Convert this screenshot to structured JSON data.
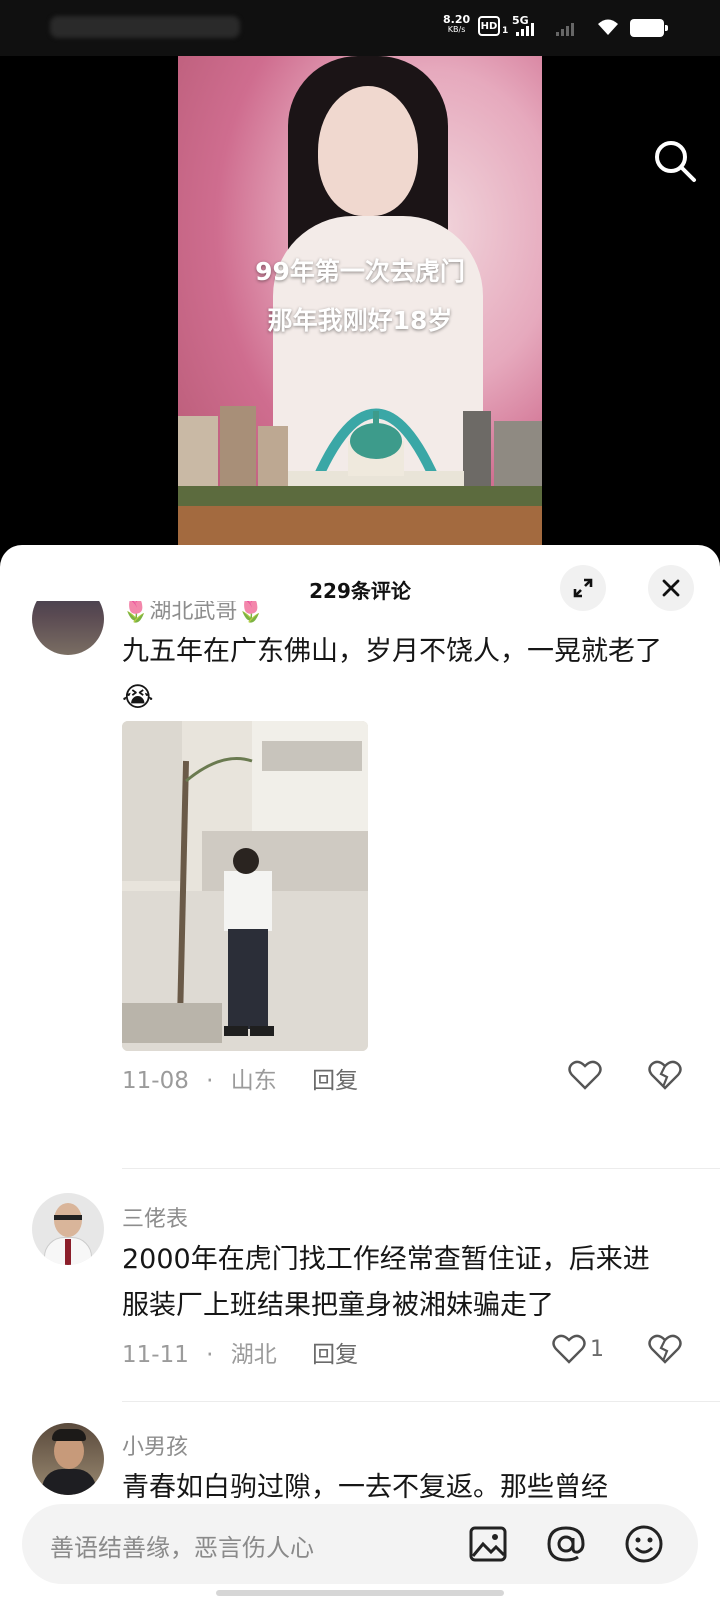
{
  "status_bar": {
    "net_speed": "8.20",
    "net_speed_unit": "KB/s",
    "hd_label": "HD",
    "hd_sub": "1",
    "network_label": "5G"
  },
  "video": {
    "caption_line1": "99年第一次去虎门",
    "caption_line2": "那年我刚好18岁",
    "search_icon": "search-icon"
  },
  "comments_panel": {
    "title": "229条评论",
    "expand_icon": "expand-icon",
    "close_icon": "close-icon",
    "comments": [
      {
        "username": "🌷湖北武哥🌷",
        "text": "九五年在广东佛山，岁月不饶人，一晃就老了😭",
        "has_photo": true,
        "date": "11-08",
        "location": "山东",
        "reply_label": "回复",
        "likes": ""
      },
      {
        "username": "三佬表",
        "text": "2000年在虎门找工作经常查暂住证，后来进服装厂上班结果把童身被湘妹骗走了",
        "has_photo": false,
        "date": "11-11",
        "location": "湖北",
        "reply_label": "回复",
        "likes": "1"
      },
      {
        "username": "小男孩",
        "text": "青春如白驹过隙，一去不复返。那些曾经",
        "has_photo": false,
        "date": "",
        "location": "",
        "reply_label": "",
        "likes": ""
      }
    ]
  },
  "input_bar": {
    "placeholder": "善语结善缘，恶言伤人心",
    "icons": [
      "image-icon",
      "at-icon",
      "emoji-icon"
    ]
  }
}
